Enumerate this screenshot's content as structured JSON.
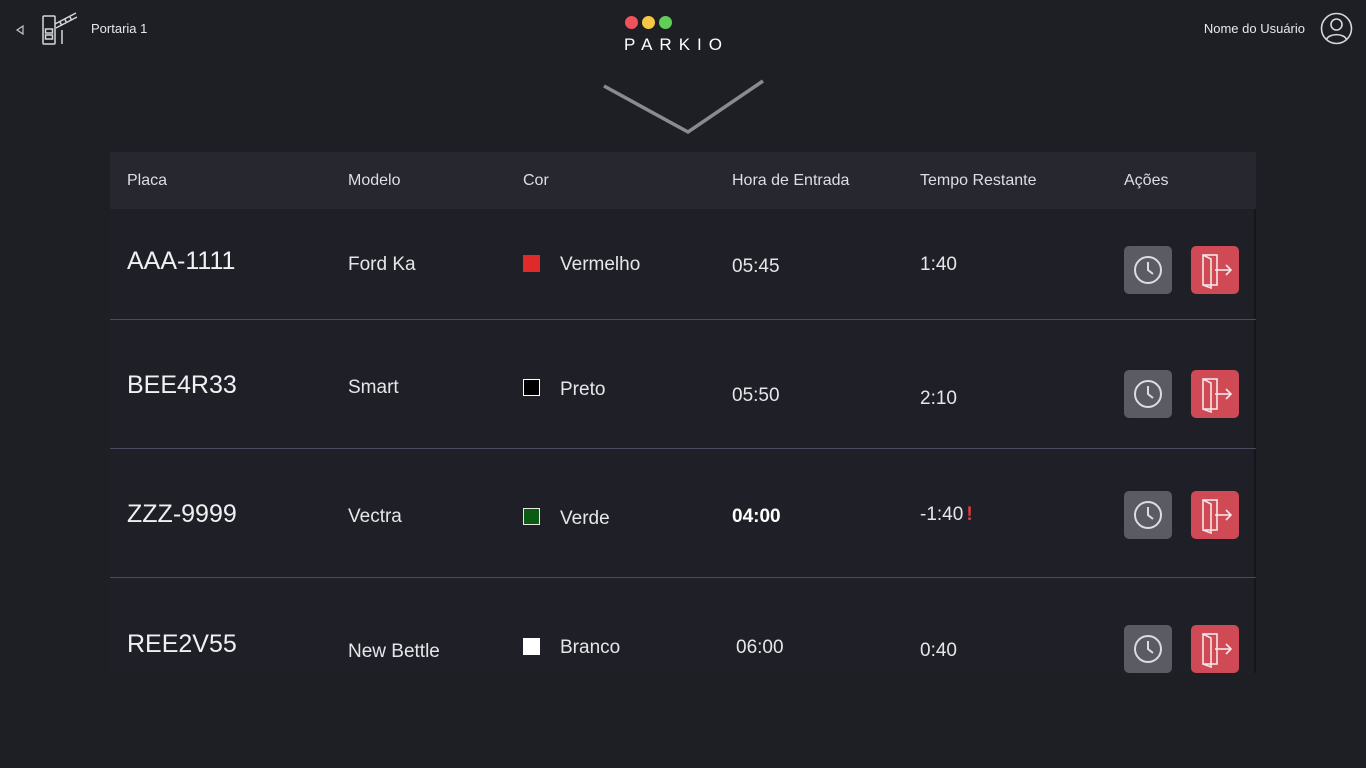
{
  "header": {
    "back_icon": "triangle-left-icon",
    "gate_icon": "parking-gate-icon",
    "gate_name": "Portaria 1",
    "logo_text": "PARKIO",
    "logo_dot_colors": [
      "#f0525a",
      "#f6c744",
      "#5fcf58"
    ],
    "user_name": "Nome do Usuário",
    "avatar_icon": "user-circle-icon",
    "collapse_icon": "chevron-down-icon"
  },
  "table": {
    "columns": {
      "plate": "Placa",
      "model": "Modelo",
      "color": "Cor",
      "entry_time": "Hora de Entrada",
      "remaining": "Tempo Restante",
      "actions": "Ações"
    },
    "rows": [
      {
        "plate": "AAA-1111",
        "model": "Ford Ka",
        "color_name": "Vermelho",
        "color_hex": "#e02a2a",
        "entry_time": "05:45",
        "remaining": "1:40",
        "overdue": false
      },
      {
        "plate": "BEE4R33",
        "model": "Smart",
        "color_name": "Preto",
        "color_hex": "#000000",
        "entry_time": "05:50",
        "remaining": "2:10",
        "overdue": false
      },
      {
        "plate": "ZZZ-9999",
        "model": "Vectra",
        "color_name": "Verde",
        "color_hex": "#0d5a12",
        "entry_time": "04:00",
        "remaining": "-1:40",
        "overdue": true,
        "overdue_mark": "!"
      },
      {
        "plate": "REE2V55",
        "model": "New Bettle",
        "color_name": "Branco",
        "color_hex": "#ffffff",
        "entry_time": "06:00",
        "remaining": "0:40",
        "overdue": false
      }
    ],
    "action_icons": [
      "clock-icon",
      "exit-door-icon"
    ],
    "action_colors": {
      "clock": "#5a5b63",
      "exit": "#cf4a55"
    }
  }
}
